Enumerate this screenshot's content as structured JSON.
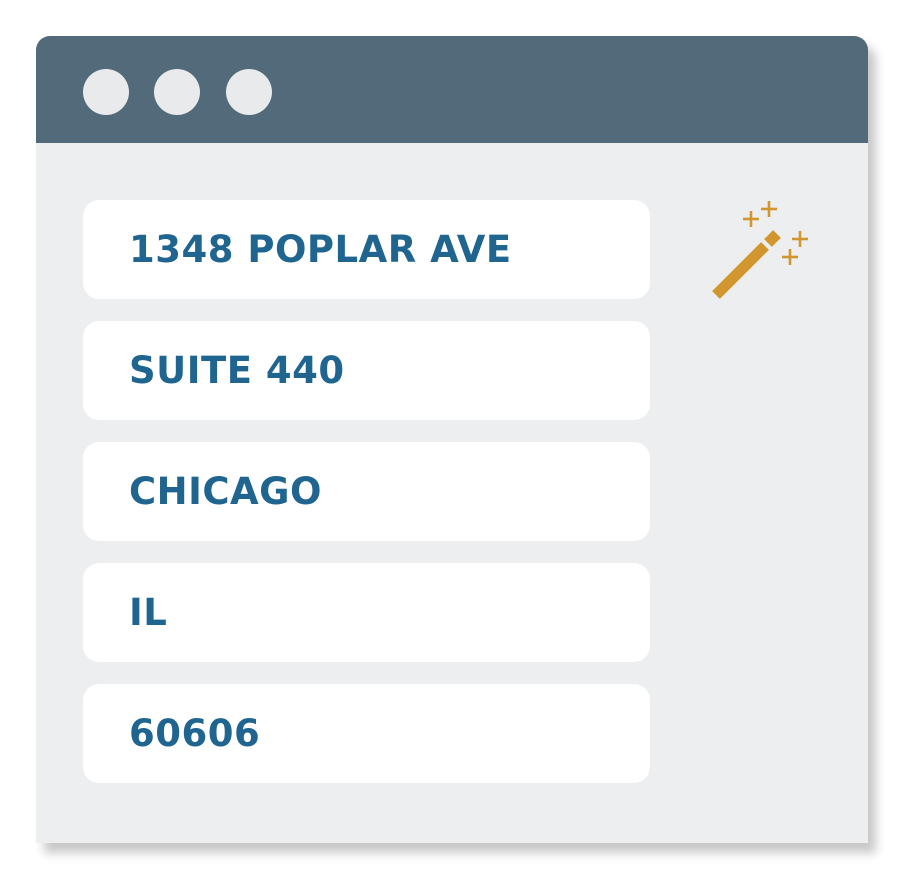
{
  "form": {
    "fields": [
      {
        "value": "1348 POPLAR AVE"
      },
      {
        "value": "SUITE 440"
      },
      {
        "value": "CHICAGO"
      },
      {
        "value": "IL"
      },
      {
        "value": "60606"
      }
    ]
  },
  "icons": {
    "autofill": "magic-wand-icon"
  },
  "colors": {
    "titlebar": "#526a79",
    "window_background": "#eceeef",
    "field_background": "#ffffff",
    "field_text": "#1f6590",
    "wand": "#d2962e",
    "window_controls": "#e8eaeb"
  }
}
